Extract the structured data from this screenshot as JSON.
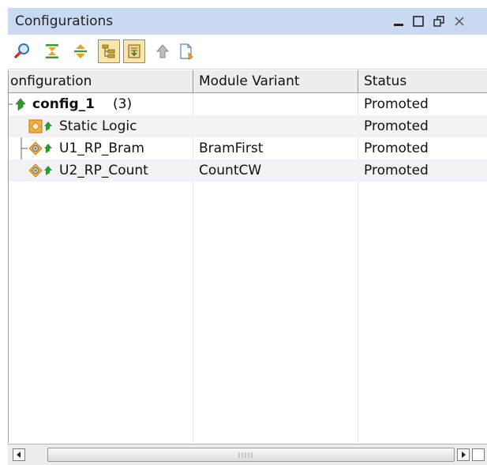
{
  "panel": {
    "title": "Configurations",
    "window_controls": [
      "minimize-icon",
      "maximize-icon",
      "restore-icon",
      "close-icon"
    ],
    "accent_color": "#c9d9f1"
  },
  "toolbar": {
    "buttons": [
      {
        "icon": "search-icon",
        "pressed": false
      },
      {
        "icon": "collapse-all-icon",
        "pressed": false
      },
      {
        "icon": "expand-all-icon",
        "pressed": false
      },
      {
        "icon": "hierarchy-view-icon",
        "pressed": true
      },
      {
        "icon": "auto-update-icon",
        "pressed": true
      },
      {
        "icon": "promote-icon",
        "pressed": false
      },
      {
        "icon": "report-icon",
        "pressed": false
      }
    ]
  },
  "table": {
    "columns": [
      "onfiguration",
      "Module Variant",
      "Status"
    ],
    "rows": [
      {
        "name": "config_1",
        "count": "(3)",
        "variant": "",
        "status": "Promoted"
      },
      {
        "name": "Static Logic",
        "variant": "",
        "status": "Promoted"
      },
      {
        "name": "U1_RP_Bram",
        "variant": "BramFirst",
        "status": "Promoted"
      },
      {
        "name": "U2_RP_Count",
        "variant": "CountCW",
        "status": "Promoted"
      }
    ]
  }
}
